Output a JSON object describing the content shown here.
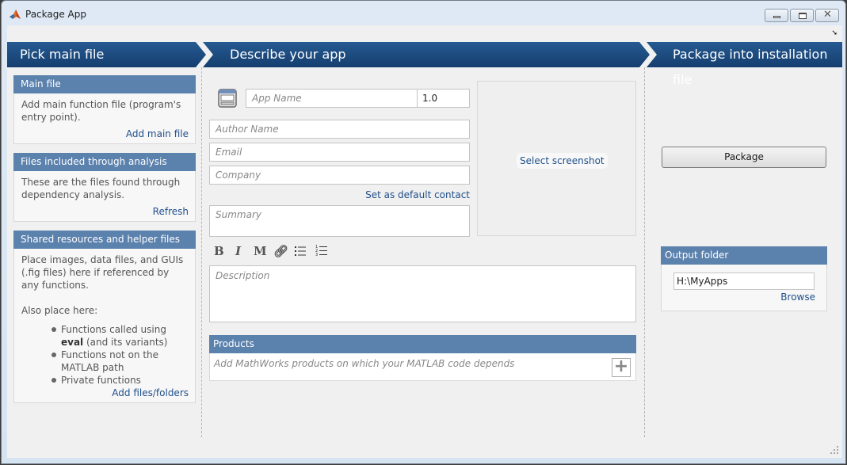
{
  "window": {
    "title": "Package App",
    "buttons": {
      "minimize": "minimize",
      "restore": "restore",
      "close": "close"
    }
  },
  "steps": [
    {
      "label": "Pick main file"
    },
    {
      "label": "Describe your app"
    },
    {
      "label": "Package into installation file"
    }
  ],
  "left": {
    "main_file": {
      "title": "Main file",
      "text": "Add main function file (program's entry point).",
      "action": "Add main file"
    },
    "analysis": {
      "title": "Files included through analysis",
      "text": "These are the files found through dependency analysis.",
      "action": "Refresh"
    },
    "shared": {
      "title": "Shared resources and helper files",
      "text": "Place images, data files, and GUIs (.fig files) here if referenced by any functions.",
      "also": "Also place here:",
      "bullets": [
        {
          "pre": "Functions called using ",
          "bold": "eval",
          "post": " (and its variants)"
        },
        {
          "text": "Functions not on the MATLAB path"
        },
        {
          "text": "Private functions"
        }
      ],
      "action": "Add files/folders"
    }
  },
  "describe": {
    "app_name_placeholder": "App Name",
    "version": "1.0",
    "author_placeholder": "Author Name",
    "email_placeholder": "Email",
    "company_placeholder": "Company",
    "default_contact": "Set as default contact",
    "summary_placeholder": "Summary",
    "screenshot_action": "Select screenshot",
    "toolbar": {
      "bold": "B",
      "italic": "I",
      "monospace": "M"
    },
    "description_placeholder": "Description",
    "products": {
      "title": "Products",
      "placeholder": "Add MathWorks products on which your MATLAB code depends",
      "add": "+"
    }
  },
  "package": {
    "button": "Package",
    "output": {
      "title": "Output folder",
      "value": "H:\\MyApps",
      "browse": "Browse"
    }
  }
}
